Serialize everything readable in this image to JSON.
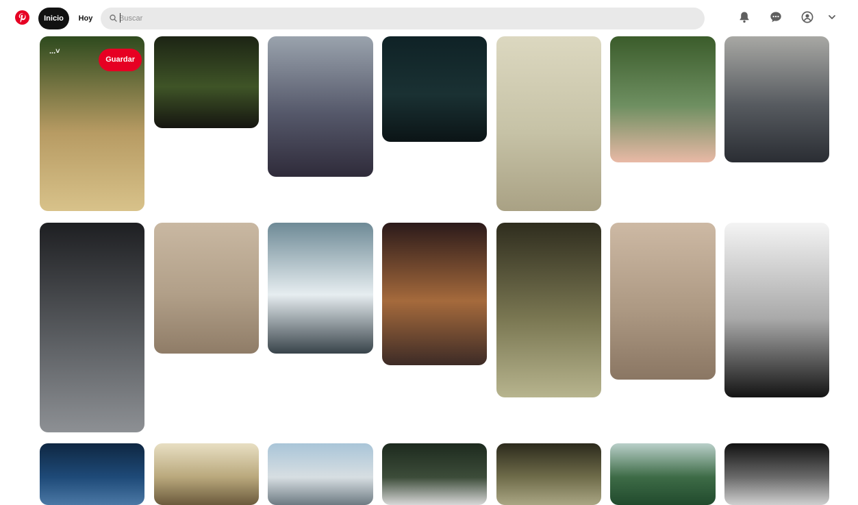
{
  "header": {
    "home_label": "Inicio",
    "today_label": "Hoy",
    "search_placeholder": "Buscar",
    "brand_color": "#e60023",
    "icons": [
      "pinterest-logo-icon",
      "search-icon",
      "bell-icon",
      "chat-bubble-icon",
      "account-circle-icon",
      "chevron-down-icon"
    ]
  },
  "hover_pin": {
    "save_label": "Guardar",
    "board_label": "..."
  },
  "pins": [
    {
      "name": "pin-wild-grass",
      "colors": [
        "#2e4a1e",
        "#b79b63",
        "#d8c28a"
      ]
    },
    {
      "name": "pin-night-fence",
      "colors": [
        "#1c2414",
        "#3f5427",
        "#151510"
      ]
    },
    {
      "name": "pin-misty-sea",
      "colors": [
        "#9aa3ad",
        "#55586a",
        "#2f2b3a"
      ]
    },
    {
      "name": "pin-night-horizon",
      "colors": [
        "#0f2226",
        "#1a3133",
        "#0b1416"
      ]
    },
    {
      "name": "pin-foggy-beach",
      "colors": [
        "#dcd8c0",
        "#c6c2a6",
        "#a9a184"
      ]
    },
    {
      "name": "pin-pine-needles",
      "colors": [
        "#3b5c2b",
        "#6e8f61",
        "#e9b9a6"
      ]
    },
    {
      "name": "pin-wet-rock",
      "colors": [
        "#a8a8a4",
        "#565a5f",
        "#2a2d33"
      ]
    },
    {
      "name": "pin-rain-drops",
      "colors": [
        "#1e1f22",
        "#5a5d61",
        "#8d9094"
      ]
    },
    {
      "name": "pin-footprints-sand",
      "colors": [
        "#c9b8a2",
        "#b19f88",
        "#8f7c67"
      ]
    },
    {
      "name": "pin-ocean-waves",
      "colors": [
        "#6e8a96",
        "#e6edf0",
        "#38434a"
      ]
    },
    {
      "name": "pin-lit-alley",
      "colors": [
        "#2b1a1a",
        "#a56a3c",
        "#3d2b26"
      ]
    },
    {
      "name": "pin-guitar-head",
      "colors": [
        "#2f2d1e",
        "#7a7752",
        "#b7b48e"
      ]
    },
    {
      "name": "pin-footprints-sand-2",
      "colors": [
        "#cdb9a4",
        "#ad9983",
        "#8a7663"
      ]
    },
    {
      "name": "pin-clock-face",
      "colors": [
        "#f4f4f4",
        "#a9a9a9",
        "#141414"
      ]
    },
    {
      "name": "pin-blue-sky",
      "colors": [
        "#0f2742",
        "#1e4a78",
        "#4b78a5"
      ]
    },
    {
      "name": "pin-vintage-car",
      "colors": [
        "#e8dfc3",
        "#b9a87c",
        "#6b5a3c"
      ]
    },
    {
      "name": "pin-sunny-road",
      "colors": [
        "#a9c5d8",
        "#d7dee2",
        "#6d7a82"
      ]
    },
    {
      "name": "pin-forest-snow",
      "colors": [
        "#1d2a1e",
        "#3c4c39",
        "#d8d8d8"
      ]
    },
    {
      "name": "pin-guitar-head-2",
      "colors": [
        "#2c2a1c",
        "#6f6c4a",
        "#aaa684"
      ]
    },
    {
      "name": "pin-green-trees",
      "colors": [
        "#b9cfc9",
        "#3d6b46",
        "#214a2d"
      ]
    },
    {
      "name": "pin-rock-snow",
      "colors": [
        "#111111",
        "#6a6a6a",
        "#cfcfcf"
      ]
    }
  ]
}
